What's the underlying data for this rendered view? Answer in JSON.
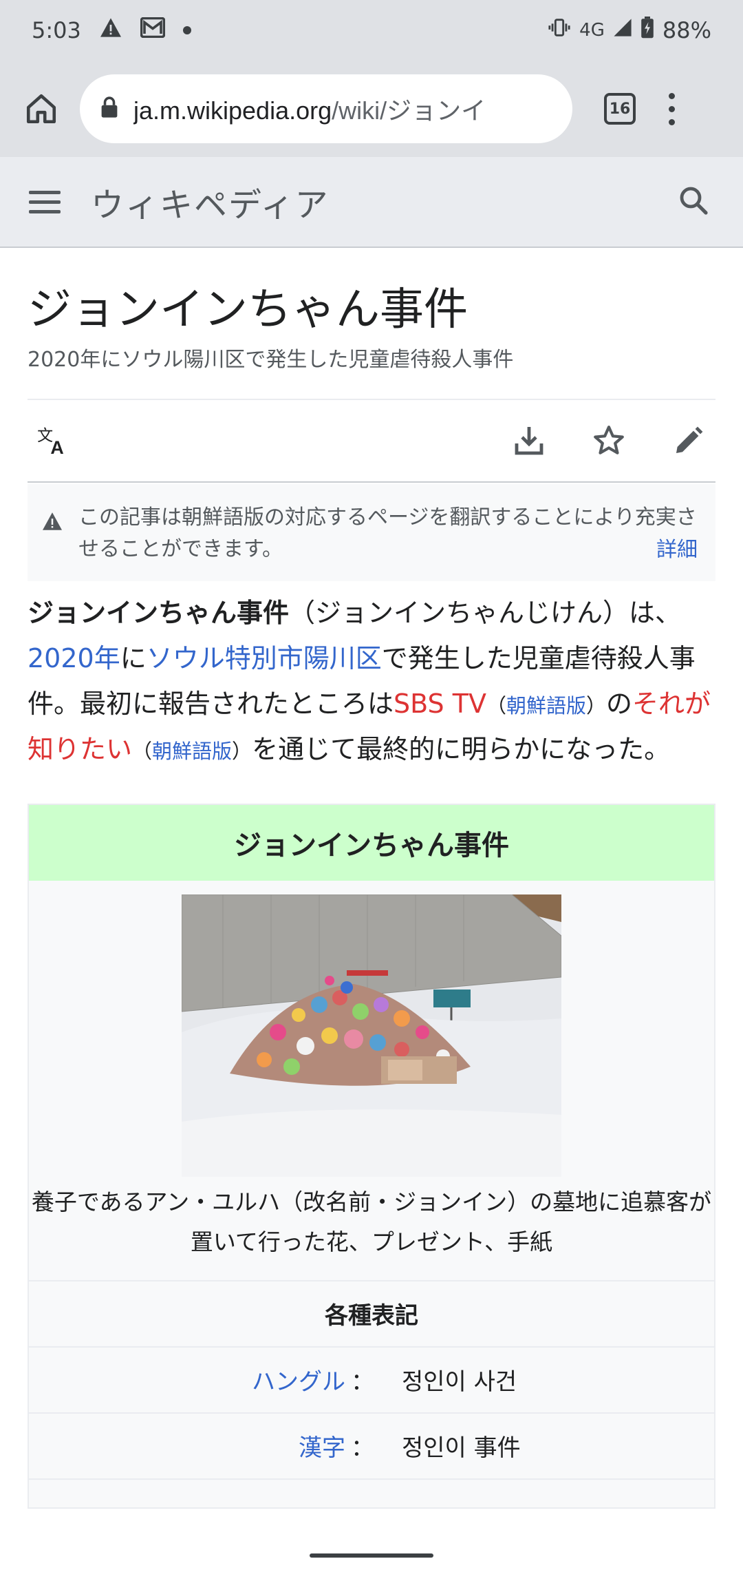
{
  "status_bar": {
    "time": "5:03",
    "network": "4G",
    "battery": "88%",
    "icons": [
      "warning-icon",
      "gmail-icon",
      "dot-icon",
      "vibrate-icon",
      "signal-icon",
      "battery-charging-icon"
    ]
  },
  "browser": {
    "url_host": "ja.m.wikipedia.org",
    "url_path": "/wiki/ジョンイ",
    "tab_count": "16",
    "icons": [
      "home-icon",
      "lock-icon",
      "tabs-icon",
      "overflow-menu-icon"
    ]
  },
  "wiki_header": {
    "wordmark": "ウィキペディア",
    "icons": [
      "menu-icon",
      "search-icon"
    ]
  },
  "page": {
    "title": "ジョンインちゃん事件",
    "subtitle": "2020年にソウル陽川区で発生した児童虐待殺人事件",
    "actions": [
      "language-icon",
      "download-icon",
      "star-icon",
      "edit-icon"
    ]
  },
  "notice": {
    "text": "この記事は朝鮮語版の対応するページを翻訳することにより充実させることができます。",
    "more_link": "詳細"
  },
  "lead": {
    "bold_title": "ジョンインちゃん事件",
    "reading": "（ジョンインちゃんじけん）は、",
    "link_year": "2020年",
    "text_ni": "に",
    "link_place": "ソウル特別市陽川区",
    "text_after_place": "で発生した児童虐待殺人事件。最初に報告されたところは",
    "link_sbs": "SBS TV",
    "paren_open_1": "（",
    "link_korean_1": "朝鮮語版",
    "paren_close_1": "）",
    "text_no": "の",
    "link_program": "それが知りたい",
    "paren_open_2": "（",
    "link_korean_2": "朝鮮語版",
    "paren_close_2": "）",
    "text_end": "を通じて最終的に明らかになった。"
  },
  "infobox": {
    "title": "ジョンインちゃん事件",
    "caption": "養子であるアン・ユルハ（改名前・ジョンイン）の墓地に追慕客が置いて行った花、プレゼント、手紙",
    "section_header": "各種表記",
    "rows": [
      {
        "label": "ハングル",
        "colon": "：",
        "value": "정인이 사건"
      },
      {
        "label": "漢字",
        "colon": "：",
        "value": "정인이 事件"
      }
    ]
  }
}
